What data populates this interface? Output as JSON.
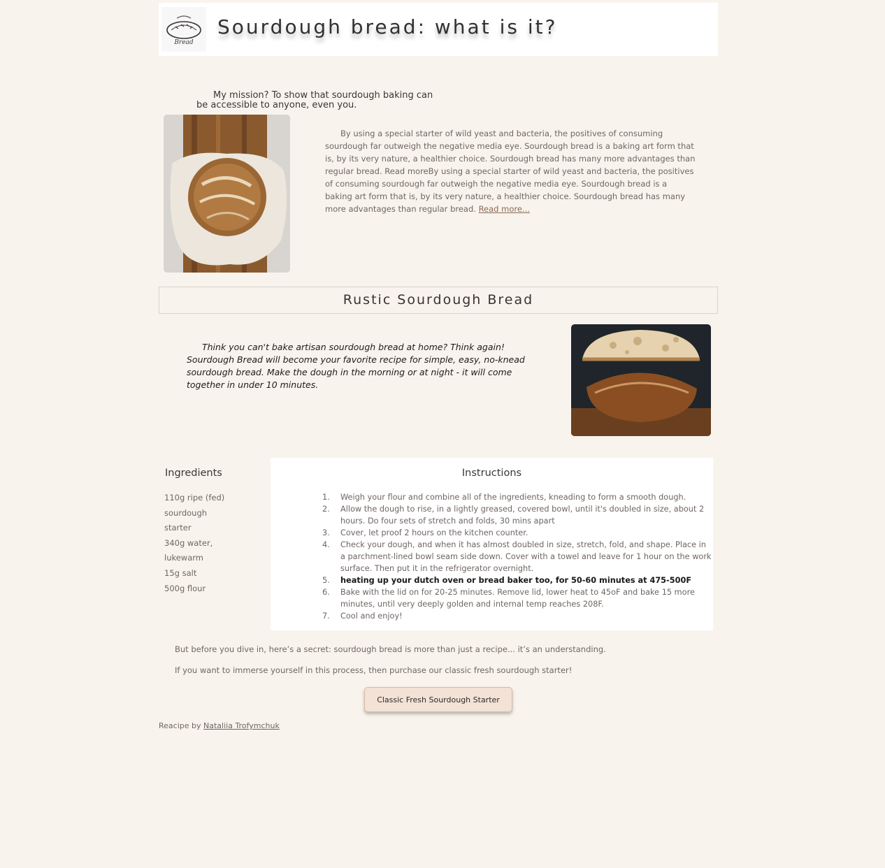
{
  "header": {
    "logo_text": "Bread",
    "title": "Sourdough bread: what is it?"
  },
  "mission": "My mission? To show that sourdough baking can be accessible to anyone, even you.",
  "intro": {
    "text": "By using a special starter of wild yeast and bacteria, the positives of consuming sourdough far outweigh the negative media eye. Sourdough bread is a baking art form that is, by its very nature, a healthier choice. Sourdough bread has many more advantages than regular bread. Read moreBy using a special starter of wild yeast and bacteria, the positives of consuming sourdough far outweigh the negative media eye. Sourdough bread is a baking art form that is, by its very nature, a healthier choice. Sourdough bread has many more advantages than regular bread.",
    "link_label": "Read more..."
  },
  "recipe": {
    "title": "Rustic Sourdough Bread",
    "lead": "Think you can't bake artisan sourdough bread at home? Think again! Sourdough Bread will become your favorite recipe for simple, easy, no-knead sourdough bread. Make the dough in the morning or at night - it will come together in under 10 minutes."
  },
  "ingredients": {
    "heading": "Ingredients",
    "items": [
      "110g ripe (fed) sourdough starter",
      "340g water, lukewarm",
      "15g salt",
      "500g flour"
    ]
  },
  "instructions": {
    "heading": "Instructions",
    "steps": [
      {
        "num": "1.",
        "text": "Weigh your flour and combine all of the ingredients, kneading to form a smooth dough."
      },
      {
        "num": "2.",
        "text": "Allow the dough to rise, in a lightly greased, covered bowl, until it's doubled in size, about 2 hours. Do four sets of stretch and folds, 30 mins apart"
      },
      {
        "num": "3.",
        "text": "Cover, let proof 2 hours on the kitchen counter."
      },
      {
        "num": "4.",
        "text": "Check your dough, and when it has almost doubled in size, stretch, fold, and shape. Place in a parchment-lined bowl seam side down. Cover with a towel and leave for 1 hour on the work surface. Then put it in the refrigerator overnight."
      },
      {
        "num": "5.",
        "text": "heating up your dutch oven or bread baker too, for 50-60 minutes at 475-500F"
      },
      {
        "num": "6.",
        "text": "Bake with the lid on for 20-25 minutes. Remove lid, lower heat to 45oF and bake 15 more minutes, until very deeply golden and internal temp reaches 208F."
      },
      {
        "num": "7.",
        "text": "Cool and enjoy!"
      }
    ]
  },
  "outro": {
    "secret": "But before you dive in, here’s a secret: sourdough bread is more than just a recipe... it’s an understanding.",
    "immerse": "If you want to immerse yourself in this process, then purchase our classic fresh sourdough starter!",
    "button_label": "Classic Fresh Sourdough Starter"
  },
  "credit": {
    "prefix": "Reacipe by",
    "author": "Nataliia Trofymchuk"
  }
}
